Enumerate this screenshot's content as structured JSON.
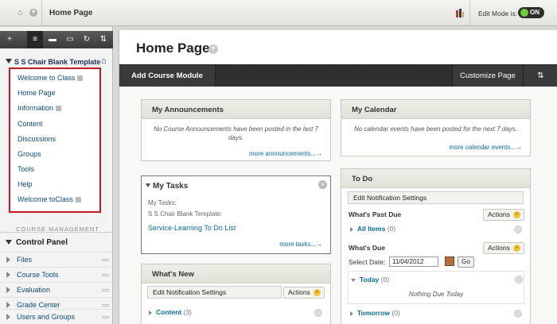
{
  "topbar": {
    "title": "Home Page",
    "edit_mode_label": "Edit Mode is:",
    "edit_mode_state": "ON"
  },
  "sidebar": {
    "tools": [
      "+",
      "≡",
      "▬",
      "▭",
      "↻",
      "⇅"
    ],
    "course_name": "S S Chair Blank Template",
    "menu_items": [
      {
        "label": "Welcome to Class",
        "has_icon": true
      },
      {
        "label": "Home Page",
        "has_icon": false
      },
      {
        "label": "Information",
        "has_icon": true
      },
      {
        "label": "Content",
        "has_icon": false
      },
      {
        "label": "Discussions",
        "has_icon": false
      },
      {
        "label": "Groups",
        "has_icon": false
      },
      {
        "label": "Tools",
        "has_icon": false
      },
      {
        "label": "Help",
        "has_icon": false
      },
      {
        "label": "Welcome toClass",
        "has_icon": true
      }
    ],
    "course_management_label": "COURSE MANAGEMENT",
    "control_panel_label": "Control Panel",
    "control_panel_items": [
      "Files",
      "Course Tools",
      "Evaluation",
      "Grade Center",
      "Users and Groups"
    ]
  },
  "main": {
    "page_title": "Home Page",
    "add_module_label": "Add Course Module",
    "customize_label": "Customize Page",
    "sort_icon": "⇅",
    "announcements": {
      "title": "My Announcements",
      "empty_text": "No Course Announcements have been posted in the last 7 days.",
      "more_link": "more announcements...→"
    },
    "calendar": {
      "title": "My Calendar",
      "empty_text": "No calendar events have been posted for the next 7 days.",
      "more_link": "more calendar events...→"
    },
    "tasks": {
      "title": "My Tasks",
      "line1": "My Tasks:",
      "line2": "S S Chair Blank Template:",
      "task_link": "Service-Learning To Do List",
      "more_link": "more tasks...→"
    },
    "whats_new": {
      "title": "What's New",
      "edit_notification": "Edit Notification Settings",
      "actions_label": "Actions",
      "content_label": "Content",
      "content_count": "(3)"
    },
    "todo": {
      "title": "To Do",
      "edit_notification": "Edit Notification Settings",
      "past_due_label": "What's Past Due",
      "actions_label": "Actions",
      "all_items_label": "All Items",
      "all_items_count": "(0)",
      "whats_due_label": "What's Due",
      "actions_label_2": "Actions",
      "select_date_label": "Select Date:",
      "date_value": "11/04/2012",
      "go_label": "Go",
      "today_label": "Today",
      "today_count": "(0)",
      "nothing_due": "Nothing Due Today",
      "tomorrow_label": "Tomorrow",
      "tomorrow_count": "(0)"
    }
  }
}
